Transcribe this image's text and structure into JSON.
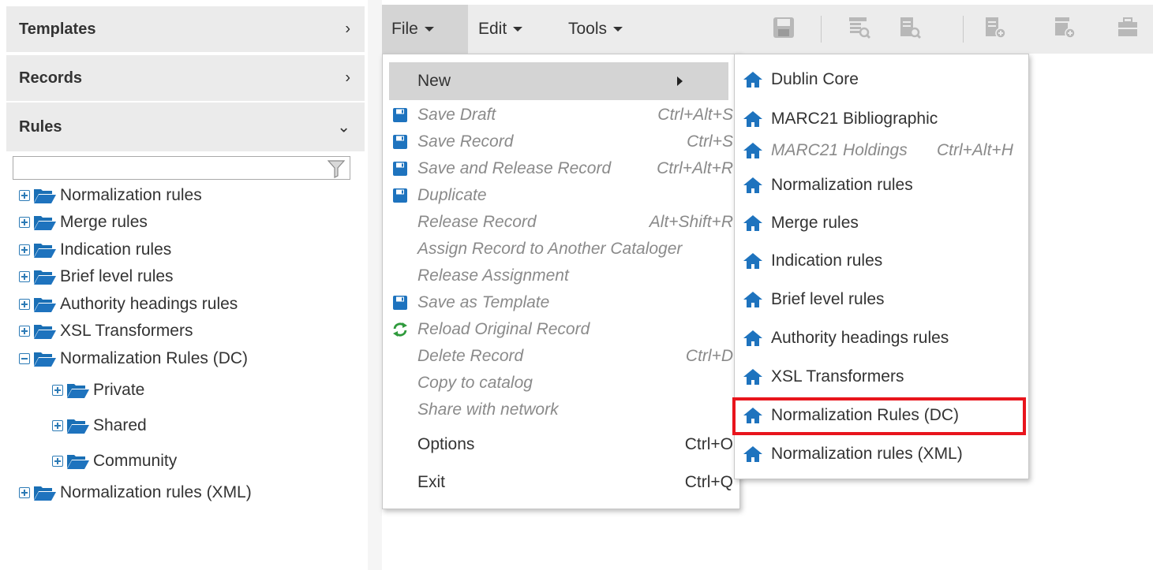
{
  "sidebar": {
    "sections": [
      {
        "label": "Templates",
        "chevron": "›"
      },
      {
        "label": "Records",
        "chevron": "›"
      },
      {
        "label": "Rules",
        "chevron": "⌄"
      }
    ],
    "filter": {
      "value": "",
      "icon": "filter-funnel-icon"
    },
    "tree": [
      {
        "label": "Normalization rules",
        "expanded": false
      },
      {
        "label": "Merge rules",
        "expanded": false
      },
      {
        "label": "Indication rules",
        "expanded": false
      },
      {
        "label": "Brief level rules",
        "expanded": false
      },
      {
        "label": "Authority headings rules",
        "expanded": false
      },
      {
        "label": "XSL Transformers",
        "expanded": false
      },
      {
        "label": "Normalization Rules (DC)",
        "expanded": true,
        "children": [
          {
            "label": "Private",
            "expanded": false
          },
          {
            "label": "Shared",
            "expanded": false
          },
          {
            "label": "Community",
            "expanded": false
          }
        ]
      },
      {
        "label": "Normalization rules (XML)",
        "expanded": false
      }
    ]
  },
  "menubar": {
    "menus": [
      "File",
      "Edit",
      "Tools"
    ],
    "active_menu": "File",
    "toolbar_icons": [
      "save-icon",
      "search-templates-icon",
      "search-records-icon",
      "new-record-icon",
      "new-template-icon",
      "toolbox-icon"
    ]
  },
  "file_menu": {
    "items": [
      {
        "label": "New",
        "shortcut": "",
        "enabled": true,
        "icon": "",
        "highlighted": true,
        "has_submenu": true
      },
      {
        "label": "Save Draft",
        "shortcut": "Ctrl+Alt+S",
        "enabled": false,
        "icon": "floppy-icon"
      },
      {
        "label": "Save Record",
        "shortcut": "Ctrl+S",
        "enabled": false,
        "icon": "floppy-icon"
      },
      {
        "label": "Save and Release Record",
        "shortcut": "Ctrl+Alt+R",
        "enabled": false,
        "icon": "floppy-icon"
      },
      {
        "label": "Duplicate",
        "shortcut": "",
        "enabled": false,
        "icon": "floppy-icon"
      },
      {
        "label": "Release Record",
        "shortcut": "Alt+Shift+R",
        "enabled": false,
        "icon": ""
      },
      {
        "label": "Assign Record to Another Cataloger",
        "shortcut": "",
        "enabled": false,
        "icon": ""
      },
      {
        "label": "Release Assignment",
        "shortcut": "",
        "enabled": false,
        "icon": ""
      },
      {
        "label": "Save as Template",
        "shortcut": "",
        "enabled": false,
        "icon": "floppy-icon"
      },
      {
        "label": "Reload Original Record",
        "shortcut": "",
        "enabled": false,
        "icon": "reload-icon"
      },
      {
        "label": "Delete Record",
        "shortcut": "Ctrl+D",
        "enabled": false,
        "icon": ""
      },
      {
        "label": "Copy to catalog",
        "shortcut": "",
        "enabled": false,
        "icon": ""
      },
      {
        "label": "Share with network",
        "shortcut": "",
        "enabled": false,
        "icon": ""
      },
      {
        "label": "Options",
        "shortcut": "Ctrl+O",
        "enabled": true,
        "icon": ""
      },
      {
        "label": "Exit",
        "shortcut": "Ctrl+Q",
        "enabled": true,
        "icon": ""
      }
    ]
  },
  "new_submenu": {
    "items": [
      {
        "label": "Dublin Core",
        "shortcut": "",
        "enabled": true
      },
      {
        "label": "MARC21 Bibliographic",
        "shortcut": "",
        "enabled": true
      },
      {
        "label": "MARC21 Holdings",
        "shortcut": "Ctrl+Alt+H",
        "enabled": false
      },
      {
        "label": "Normalization rules",
        "shortcut": "",
        "enabled": true
      },
      {
        "label": "Merge rules",
        "shortcut": "",
        "enabled": true
      },
      {
        "label": "Indication rules",
        "shortcut": "",
        "enabled": true
      },
      {
        "label": "Brief level rules",
        "shortcut": "",
        "enabled": true
      },
      {
        "label": "Authority headings rules",
        "shortcut": "",
        "enabled": true
      },
      {
        "label": "XSL Transformers",
        "shortcut": "",
        "enabled": true
      },
      {
        "label": "Normalization Rules (DC)",
        "shortcut": "",
        "enabled": true,
        "annotated": true
      },
      {
        "label": "Normalization rules (XML)",
        "shortcut": "",
        "enabled": true
      }
    ],
    "icon": "home-icon"
  },
  "colors": {
    "accent_blue": "#1e73be",
    "annotation_red": "#e8141c",
    "menubar_bg": "#ececec",
    "active_bg": "#d4d4d4",
    "disabled_text": "#8a8a8a"
  }
}
